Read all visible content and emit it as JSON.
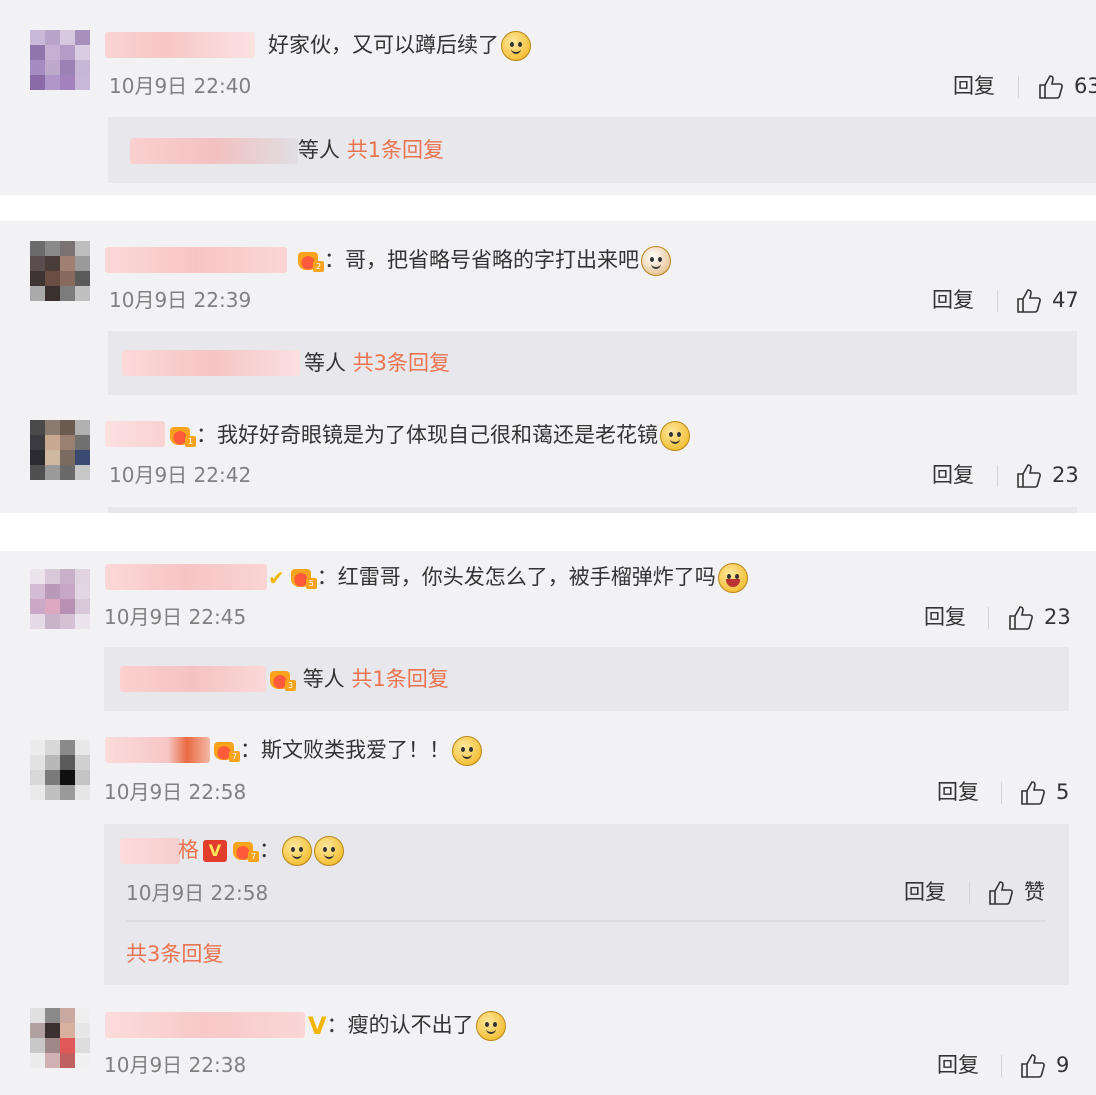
{
  "colors": {
    "accent": "#eb7350",
    "background": "#f2f2f5",
    "meta": "#808080"
  },
  "comments": [
    {
      "text": "好家伙，又可以蹲后续了",
      "time": "10月9日 22:40",
      "reply": "回复",
      "likes": "63",
      "thread": {
        "suffix": "等人",
        "count": "共1条回复"
      }
    },
    {
      "text": "：哥，把省略号省略的字打出来吧",
      "time": "10月9日 22:39",
      "reply": "回复",
      "likes": "47",
      "thread": {
        "suffix": "等人",
        "count": "共3条回复"
      }
    },
    {
      "text": "：我好好奇眼镜是为了体现自己很和蔼还是老花镜",
      "time": "10月9日 22:42",
      "reply": "回复",
      "likes": "23"
    },
    {
      "text": "：红雷哥，你头发怎么了，被手榴弹炸了吗",
      "time": "10月9日 22:45",
      "reply": "回复",
      "likes": "23",
      "thread": {
        "suffix": "等人",
        "count": "共1条回复"
      }
    },
    {
      "text": "：斯文败类我爱了！！",
      "time": "10月9日 22:58",
      "reply": "回复",
      "likes": "5",
      "subreply": {
        "name_tail": "格",
        "colon": "：",
        "time": "10月9日 22:58",
        "reply": "回复",
        "like_label": "赞"
      },
      "thread_more": "共3条回复"
    },
    {
      "text": "：瘦的认不出了",
      "time": "10月9日 22:38",
      "reply": "回复",
      "likes": "9"
    }
  ]
}
